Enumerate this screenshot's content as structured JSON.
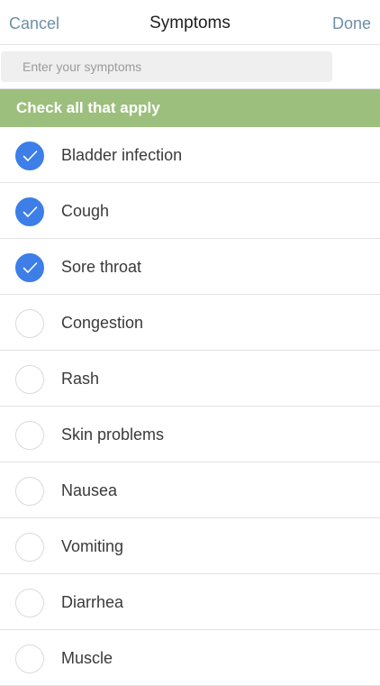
{
  "nav": {
    "cancel_label": "Cancel",
    "title": "Symptoms",
    "done_label": "Done"
  },
  "search": {
    "placeholder": "Enter your symptoms",
    "value": ""
  },
  "banner": {
    "text": "Check all that apply"
  },
  "symptoms": [
    {
      "label": "Bladder infection",
      "checked": true
    },
    {
      "label": "Cough",
      "checked": true
    },
    {
      "label": "Sore throat",
      "checked": true
    },
    {
      "label": "Congestion",
      "checked": false
    },
    {
      "label": "Rash",
      "checked": false
    },
    {
      "label": "Skin problems",
      "checked": false
    },
    {
      "label": "Nausea",
      "checked": false
    },
    {
      "label": "Vomiting",
      "checked": false
    },
    {
      "label": "Diarrhea",
      "checked": false
    },
    {
      "label": "Muscle",
      "checked": false
    }
  ],
  "colors": {
    "accent": "#3d7ee8",
    "banner": "#9dbf7e",
    "nav_link": "#6d8fa8"
  },
  "icons": {
    "checked": "checkmark-icon",
    "unchecked": "empty-circle-icon"
  }
}
